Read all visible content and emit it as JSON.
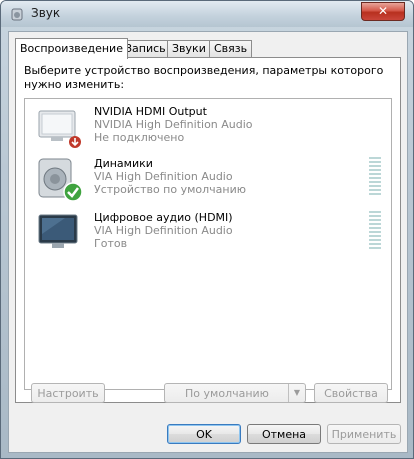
{
  "window": {
    "title": "Звук",
    "close_glyph": "✕"
  },
  "tabs": [
    {
      "label": "Воспроизведение",
      "active": true
    },
    {
      "label": "Запись",
      "active": false
    },
    {
      "label": "Звуки",
      "active": false
    },
    {
      "label": "Связь",
      "active": false
    }
  ],
  "instruction": "Выберите устройство воспроизведения, параметры которого нужно изменить:",
  "devices": [
    {
      "name": "NVIDIA HDMI Output",
      "driver": "NVIDIA High Definition Audio",
      "status": "Не подключено",
      "icon": "monitor-disconnected-icon",
      "meter": false
    },
    {
      "name": "Динамики",
      "driver": "VIA High Definition Audio",
      "status": "Устройство по умолчанию",
      "icon": "speaker-default-icon",
      "meter": true
    },
    {
      "name": "Цифровое аудио (HDMI)",
      "driver": "VIA High Definition Audio",
      "status": "Готов",
      "icon": "monitor-icon",
      "meter": true
    }
  ],
  "buttons": {
    "configure": {
      "label": "Настроить",
      "enabled": false
    },
    "set_default": {
      "label": "По умолчанию",
      "enabled": false
    },
    "properties": {
      "label": "Свойства",
      "enabled": false
    },
    "ok": {
      "label": "OK"
    },
    "cancel": {
      "label": "Отмена"
    },
    "apply": {
      "label": "Применить",
      "enabled": false
    }
  },
  "colors": {
    "default_check": "#3fa33f",
    "disconnected_badge": "#c0392b",
    "meter_bar": "#bcd7d7"
  }
}
